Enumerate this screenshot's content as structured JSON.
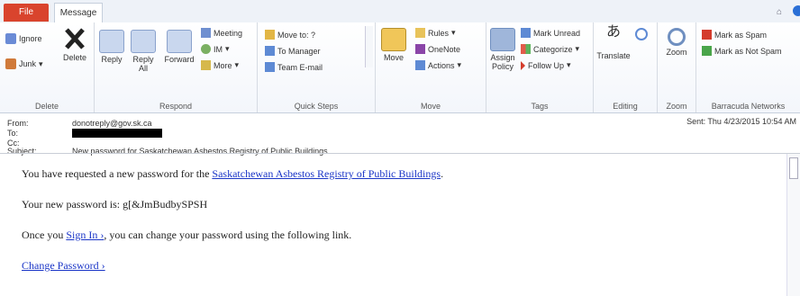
{
  "tabs": {
    "file": "File",
    "message": "Message"
  },
  "ribbon": {
    "delete_group": {
      "label": "Delete",
      "ignore": "Ignore",
      "junk": "Junk",
      "delete": "Delete"
    },
    "respond_group": {
      "label": "Respond",
      "reply": "Reply",
      "reply_all": "Reply All",
      "forward": "Forward",
      "meeting": "Meeting",
      "im": "IM",
      "more": "More"
    },
    "quick_steps_group": {
      "label": "Quick Steps",
      "items": [
        "Move to: ?",
        "To Manager",
        "Team E-mail"
      ]
    },
    "move_group": {
      "label": "Move",
      "move": "Move",
      "rules": "Rules",
      "onenote": "OneNote",
      "actions": "Actions"
    },
    "tags_group": {
      "label": "Tags",
      "assign_policy": "Assign Policy",
      "mark_unread": "Mark Unread",
      "categorize": "Categorize",
      "follow_up": "Follow Up"
    },
    "editing_group": {
      "label": "Editing",
      "translate": "Translate"
    },
    "zoom_group": {
      "label": "Zoom",
      "zoom": "Zoom"
    },
    "barracuda_group": {
      "label": "Barracuda Networks",
      "mark_spam": "Mark as Spam",
      "mark_not_spam": "Mark as Not Spam"
    }
  },
  "header": {
    "from_label": "From:",
    "from_value": "donotreply@gov.sk.ca",
    "to_label": "To:",
    "cc_label": "Cc:",
    "subject_label": "Subject:",
    "subject_value": "New password for Saskatchewan Asbestos Registry of Public Buildings",
    "sent_label": "Sent:",
    "sent_value": "Thu 4/23/2015 10:54 AM"
  },
  "body": {
    "line1_prefix": "You have requested a new password for the ",
    "registry_link": "Saskatchewan Asbestos Registry of Public Buildings",
    "line1_suffix": ".",
    "line2": "Your new password is: g[&JmBudbySPSH",
    "line3_prefix": "Once you ",
    "signin_link": "Sign In ›",
    "line3_suffix": ", you can change your password using the following link.",
    "change_link": "Change Password ›"
  },
  "colors": {
    "file_tab": "#d9442d",
    "link": "#1a35c7"
  },
  "icons": [
    "ignore-icon",
    "junk-icon",
    "delete-icon",
    "reply-icon",
    "reply-all-icon",
    "forward-icon",
    "meeting-icon",
    "im-icon",
    "more-icon",
    "move-to-icon",
    "to-manager-icon",
    "team-email-icon",
    "move-icon",
    "rules-icon",
    "onenote-icon",
    "actions-icon",
    "assign-policy-icon",
    "mark-unread-icon",
    "categorize-icon",
    "follow-up-icon",
    "translate-icon",
    "find-icon",
    "zoom-icon",
    "mark-spam-icon",
    "mark-not-spam-icon"
  ]
}
